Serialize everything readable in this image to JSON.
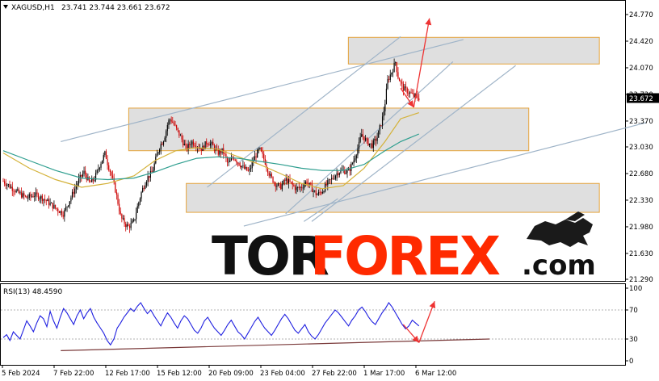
{
  "header": {
    "symbol": "XAGUSD,H1",
    "ohlc": "23.741 23.744 23.661 23.672"
  },
  "rsi_header": {
    "label": "RSI(13) 48.4590"
  },
  "watermark": {
    "part1": "TOR",
    "part2": "FOREX",
    "part3": ".com"
  },
  "colors": {
    "candle_up": "#000000",
    "candle_down": "#cc0000",
    "ma_fast": "#d4b23a",
    "ma_slow": "#2e9e8f",
    "trendline": "#9fb4c8",
    "zone_fill": "#d9d9d9",
    "zone_border": "#e5a33a",
    "arrow": "#ee3333",
    "rsi_line": "#1f1fe0",
    "rsi_support": "#7a3a3a",
    "price_marker_bg": "#000000",
    "watermark_dark": "#111111",
    "watermark_red": "#ff2a00"
  },
  "chart_data": [
    {
      "type": "candlestick",
      "symbol": "XAGUSD",
      "timeframe": "H1",
      "current_price": 23.672,
      "current_price_label": "23.672",
      "y_ticks": [
        "24.770",
        "24.420",
        "24.070",
        "23.720",
        "23.370",
        "23.030",
        "22.680",
        "22.330",
        "21.980",
        "21.630",
        "21.290"
      ],
      "ylim": [
        21.29,
        24.77
      ],
      "x_ticks": [
        "5 Feb 2024",
        "7 Feb 22:00",
        "12 Feb 17:00",
        "15 Feb 12:00",
        "20 Feb 09:00",
        "23 Feb 04:00",
        "27 Feb 22:00",
        "1 Mar 17:00",
        "6 Mar 12:00"
      ],
      "price_path": [
        [
          0,
          22.58
        ],
        [
          3,
          22.5
        ],
        [
          6,
          22.42
        ],
        [
          9,
          22.36
        ],
        [
          12,
          22.4
        ],
        [
          15,
          22.36
        ],
        [
          18,
          22.28
        ],
        [
          21,
          22.2
        ],
        [
          23,
          22.15
        ],
        [
          25,
          22.3
        ],
        [
          27,
          22.45
        ],
        [
          29,
          22.6
        ],
        [
          31,
          22.7
        ],
        [
          33,
          22.55
        ],
        [
          35,
          22.62
        ],
        [
          37,
          22.8
        ],
        [
          39,
          22.95
        ],
        [
          40,
          22.8
        ],
        [
          41,
          22.7
        ],
        [
          43,
          22.45
        ],
        [
          45,
          22.1
        ],
        [
          47,
          22.0
        ],
        [
          48,
          21.98
        ],
        [
          50,
          22.05
        ],
        [
          51,
          22.2
        ],
        [
          53,
          22.45
        ],
        [
          55,
          22.62
        ],
        [
          57,
          22.7
        ],
        [
          59,
          22.95
        ],
        [
          60,
          23.05
        ],
        [
          61,
          23.1
        ],
        [
          62,
          23.2
        ],
        [
          63,
          23.35
        ],
        [
          64,
          23.4
        ],
        [
          66,
          23.28
        ],
        [
          68,
          23.15
        ],
        [
          70,
          23.0
        ],
        [
          72,
          23.1
        ],
        [
          74,
          23.05
        ],
        [
          76,
          23.0
        ],
        [
          78,
          23.1
        ],
        [
          80,
          23.05
        ],
        [
          82,
          22.95
        ],
        [
          84,
          22.98
        ],
        [
          86,
          22.8
        ],
        [
          88,
          22.9
        ],
        [
          90,
          22.82
        ],
        [
          92,
          22.75
        ],
        [
          94,
          22.7
        ],
        [
          96,
          22.88
        ],
        [
          98,
          23.0
        ],
        [
          100,
          22.85
        ],
        [
          102,
          22.65
        ],
        [
          104,
          22.55
        ],
        [
          106,
          22.5
        ],
        [
          108,
          22.6
        ],
        [
          110,
          22.55
        ],
        [
          112,
          22.48
        ],
        [
          114,
          22.5
        ],
        [
          116,
          22.58
        ],
        [
          118,
          22.48
        ],
        [
          120,
          22.4
        ],
        [
          122,
          22.45
        ],
        [
          124,
          22.55
        ],
        [
          126,
          22.62
        ],
        [
          128,
          22.7
        ],
        [
          130,
          22.72
        ],
        [
          132,
          22.7
        ],
        [
          134,
          22.85
        ],
        [
          136,
          23.05
        ],
        [
          137,
          23.2
        ],
        [
          139,
          23.1
        ],
        [
          141,
          23.05
        ],
        [
          143,
          23.15
        ],
        [
          145,
          23.4
        ],
        [
          146,
          23.6
        ],
        [
          147,
          23.9
        ],
        [
          149,
          24.05
        ],
        [
          150,
          24.15
        ],
        [
          151,
          23.95
        ],
        [
          153,
          23.8
        ],
        [
          155,
          23.75
        ],
        [
          157,
          23.7
        ],
        [
          159,
          23.672
        ]
      ],
      "ma_fast_path": [
        [
          0,
          22.95
        ],
        [
          10,
          22.75
        ],
        [
          20,
          22.6
        ],
        [
          30,
          22.5
        ],
        [
          40,
          22.55
        ],
        [
          50,
          22.65
        ],
        [
          58,
          22.85
        ],
        [
          66,
          22.98
        ],
        [
          74,
          23.02
        ],
        [
          82,
          23.0
        ],
        [
          90,
          22.9
        ],
        [
          98,
          22.8
        ],
        [
          106,
          22.68
        ],
        [
          114,
          22.55
        ],
        [
          122,
          22.48
        ],
        [
          130,
          22.52
        ],
        [
          138,
          22.75
        ],
        [
          146,
          23.1
        ],
        [
          152,
          23.4
        ],
        [
          159,
          23.48
        ]
      ],
      "ma_slow_path": [
        [
          0,
          22.98
        ],
        [
          10,
          22.85
        ],
        [
          20,
          22.72
        ],
        [
          30,
          22.62
        ],
        [
          40,
          22.6
        ],
        [
          50,
          22.62
        ],
        [
          58,
          22.7
        ],
        [
          66,
          22.8
        ],
        [
          74,
          22.88
        ],
        [
          82,
          22.9
        ],
        [
          90,
          22.88
        ],
        [
          98,
          22.84
        ],
        [
          106,
          22.8
        ],
        [
          114,
          22.75
        ],
        [
          122,
          22.72
        ],
        [
          130,
          22.72
        ],
        [
          138,
          22.8
        ],
        [
          146,
          22.98
        ],
        [
          152,
          23.1
        ],
        [
          159,
          23.2
        ]
      ],
      "zones": [
        {
          "x0": 132,
          "x1": 228,
          "y_top": 24.47,
          "y_bottom": 24.12
        },
        {
          "x0": 48,
          "x1": 201,
          "y_top": 23.54,
          "y_bottom": 22.98
        },
        {
          "x0": 70,
          "x1": 228,
          "y_top": 22.55,
          "y_bottom": 22.17
        }
      ],
      "trendlines": [
        {
          "x0": 22,
          "y0": 23.1,
          "x1": 176,
          "y1": 24.44
        },
        {
          "x0": 78,
          "y0": 22.5,
          "x1": 152,
          "y1": 24.48
        },
        {
          "x0": 108,
          "y0": 22.15,
          "x1": 172,
          "y1": 24.15
        },
        {
          "x0": 118,
          "y0": 22.05,
          "x1": 196,
          "y1": 24.1
        },
        {
          "x0": 92,
          "y0": 21.99,
          "x1": 246,
          "y1": 23.35
        },
        {
          "x0": 115,
          "y0": 22.05,
          "x1": 128,
          "y1": 22.35
        }
      ],
      "forecast_arrows": [
        {
          "points": [
            [
              152,
              23.8
            ],
            [
              157,
              23.55
            ]
          ]
        },
        {
          "points": [
            [
              157,
              23.55
            ],
            [
              163,
              24.72
            ]
          ]
        }
      ]
    },
    {
      "type": "line",
      "indicator": "RSI",
      "period": 13,
      "current_value": 48.459,
      "ylim": [
        0,
        100
      ],
      "y_ticks": [
        "100",
        "70",
        "30",
        "0"
      ],
      "levels": [
        70,
        30
      ],
      "values": [
        32,
        36,
        28,
        40,
        35,
        30,
        42,
        55,
        48,
        40,
        52,
        62,
        58,
        47,
        68,
        55,
        45,
        60,
        72,
        66,
        58,
        50,
        62,
        70,
        58,
        66,
        72,
        60,
        52,
        45,
        38,
        28,
        22,
        30,
        45,
        52,
        60,
        66,
        72,
        68,
        75,
        80,
        72,
        65,
        70,
        62,
        55,
        48,
        58,
        66,
        60,
        52,
        45,
        55,
        62,
        58,
        50,
        42,
        38,
        45,
        55,
        60,
        52,
        45,
        40,
        35,
        42,
        50,
        56,
        48,
        40,
        36,
        30,
        38,
        46,
        54,
        60,
        52,
        45,
        40,
        35,
        42,
        50,
        58,
        64,
        58,
        50,
        42,
        38,
        44,
        50,
        40,
        34,
        30,
        36,
        44,
        52,
        58,
        64,
        70,
        66,
        60,
        54,
        48,
        56,
        62,
        70,
        74,
        68,
        60,
        54,
        50,
        58,
        66,
        72,
        80,
        74,
        66,
        58,
        50,
        44,
        48,
        56,
        52,
        48
      ],
      "support_line": {
        "x0": 22,
        "y0": 14,
        "x1": 186,
        "y1": 30
      },
      "forecast_arrows": [
        {
          "points": [
            [
              153,
              50
            ],
            [
              159,
              25
            ]
          ]
        },
        {
          "points": [
            [
              159,
              25
            ],
            [
              165,
              82
            ]
          ]
        }
      ]
    }
  ]
}
